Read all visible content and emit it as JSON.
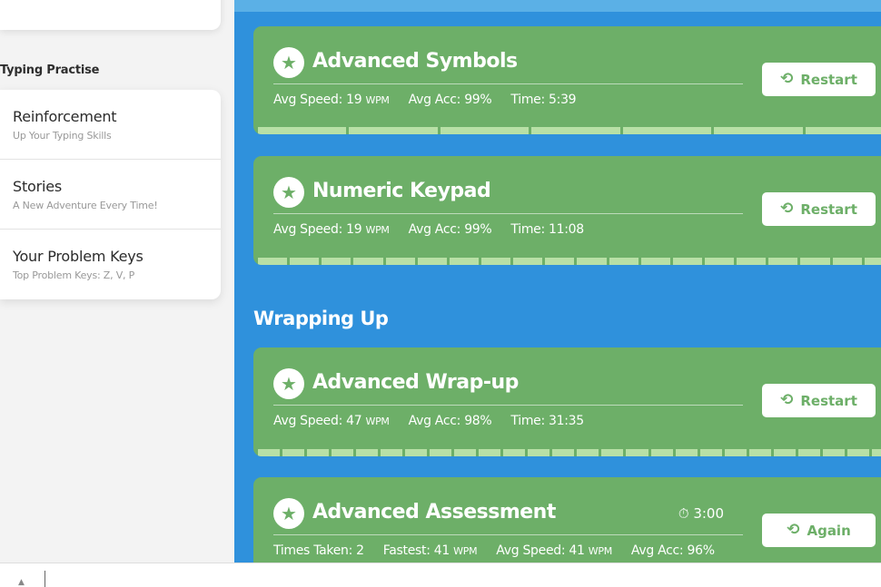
{
  "sidebar": {
    "heading": "Typing Practise",
    "items": [
      {
        "title": "Reinforcement",
        "subtitle": "Up Your Typing Skills"
      },
      {
        "title": "Stories",
        "subtitle": "A New Adventure Every Time!"
      },
      {
        "title": "Your Problem Keys",
        "subtitle": "Top Problem Keys: Z, V, P"
      }
    ]
  },
  "main": {
    "section_title": "Wrapping Up",
    "lessons": [
      {
        "title": "Advanced Symbols",
        "button": "Restart",
        "stats": {
          "speed_label": "Avg Speed: 19",
          "speed_unit": "WPM",
          "acc": "Avg Acc: 99%",
          "time": "Time: 5:39"
        },
        "progress_segments": 7
      },
      {
        "title": "Numeric Keypad",
        "button": "Restart",
        "stats": {
          "speed_label": "Avg Speed: 19",
          "speed_unit": "WPM",
          "acc": "Avg Acc: 99%",
          "time": "Time: 11:08"
        },
        "progress_segments": 20
      },
      {
        "title": "Advanced Wrap-up",
        "button": "Restart",
        "stats": {
          "speed_label": "Avg Speed: 47",
          "speed_unit": "WPM",
          "acc": "Avg Acc: 98%",
          "time": "Time: 31:35"
        },
        "progress_segments": 26
      },
      {
        "title": "Advanced Assessment",
        "button": "Again",
        "timer": "3:00",
        "stats": {
          "times_taken": "Times Taken: 2",
          "fastest_label": "Fastest: 41",
          "fastest_unit": "WPM",
          "speed_label": "Avg Speed: 41",
          "speed_unit": "WPM",
          "acc": "Avg Acc: 96%"
        }
      }
    ]
  },
  "colors": {
    "main_bg": "#2f91dc",
    "card_green": "#6daf68",
    "progress_green": "#b8e0a6",
    "sidebar_bg": "#f3f3f3"
  },
  "icons": {
    "lesson_badge": "star-icon",
    "restart": "history-icon",
    "timer": "stopwatch-icon"
  }
}
